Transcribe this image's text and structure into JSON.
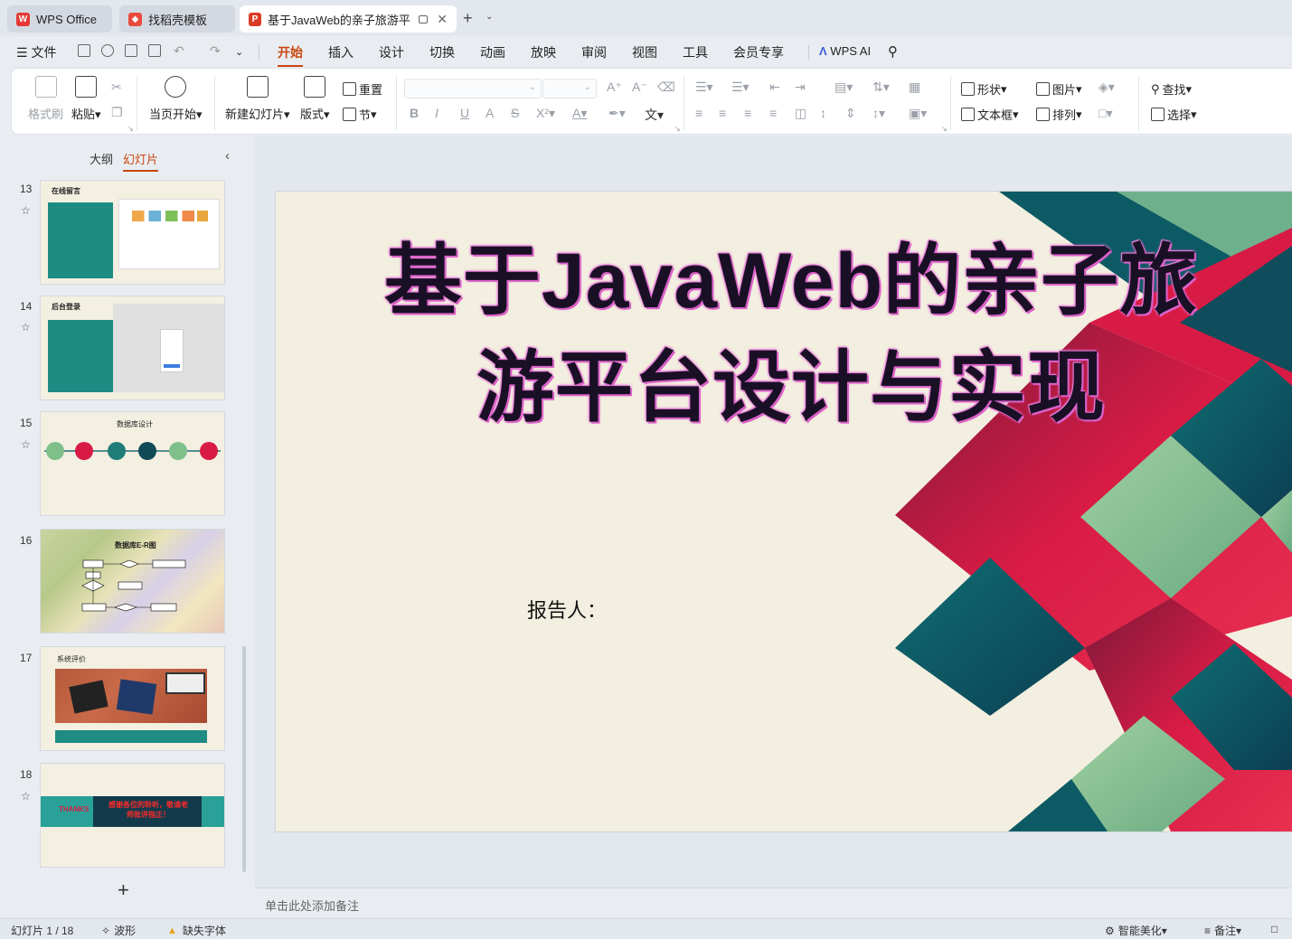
{
  "tabs": [
    {
      "label": "WPS Office",
      "icon": "wps-logo-icon"
    },
    {
      "label": "找稻壳模板",
      "icon": "docer-icon"
    },
    {
      "label": "基于JavaWeb的亲子旅游平台",
      "icon": "ppt-icon"
    }
  ],
  "menu": {
    "file": "文件",
    "items": [
      "开始",
      "插入",
      "设计",
      "切换",
      "动画",
      "放映",
      "审阅",
      "视图",
      "工具",
      "会员专享"
    ],
    "active": "开始",
    "ai": "WPS AI"
  },
  "ribbon": {
    "format_painter": "格式刷",
    "paste": "粘贴",
    "from_start": "当页开始",
    "new_slide": "新建幻灯片",
    "layout": "版式",
    "reset": "重置",
    "section": "节",
    "shape": "形状",
    "picture": "图片",
    "textbox": "文本框",
    "arrange": "排列",
    "find": "查找",
    "select": "选择"
  },
  "panel": {
    "outline_tab": "大纲",
    "slides_tab": "幻灯片",
    "slides": [
      {
        "num": "13",
        "title": "在线留言"
      },
      {
        "num": "14",
        "title": "后台登录"
      },
      {
        "num": "15",
        "title": "数据库设计"
      },
      {
        "num": "16",
        "title": "数据库E-R图"
      },
      {
        "num": "17",
        "title": "系统评价"
      },
      {
        "num": "18",
        "title": "感谢各位的聆听，敬请老师批评指正！",
        "left": "THANKS"
      }
    ]
  },
  "slide": {
    "title_line1": "基于JavaWeb的亲子旅",
    "title_line2": "游平台设计与实现",
    "reporter": "报告人："
  },
  "notes_placeholder": "单击此处添加备注",
  "status": {
    "slide_counter": "幻灯片 1 / 18",
    "theme": "波形",
    "missing_font": "缺失字体",
    "beautify": "智能美化",
    "notes": "备注"
  },
  "colors": {
    "accent": "#c8460e",
    "slide_bg": "#f3efe0",
    "teal": "#0e5c63",
    "crimson": "#d81b45",
    "green": "#7fbf8a"
  }
}
